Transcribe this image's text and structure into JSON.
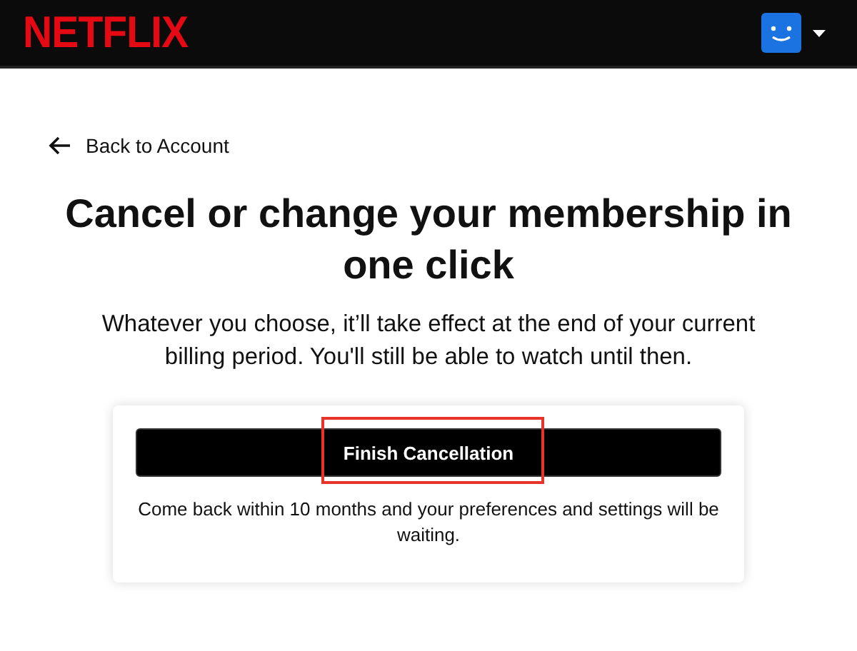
{
  "header": {
    "logo": "NETFLIX",
    "profile_menu": {
      "has_caret": true
    }
  },
  "back_link": {
    "label": "Back to Account"
  },
  "title": "Cancel or change your membership in one click",
  "subtitle": "Whatever you choose, it’ll take effect at the end of your current billing period. You'll still be able to watch until then.",
  "card": {
    "button": {
      "label": "Finish Cancellation",
      "highlighted": true
    },
    "note": "Come back within 10 months and your preferences and settings will be waiting."
  }
}
